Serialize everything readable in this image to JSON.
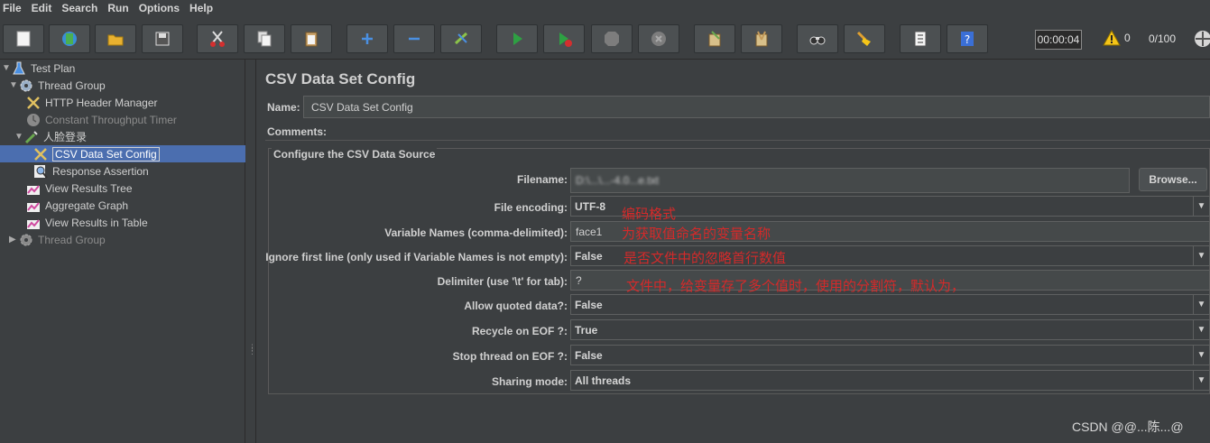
{
  "menu": [
    "File",
    "Edit",
    "Search",
    "Run",
    "Options",
    "Help"
  ],
  "toolbar": {
    "buttons": [
      "new-icon",
      "templates-icon",
      "open-icon",
      "save-icon",
      "cut-icon",
      "copy-icon",
      "paste-icon",
      "expand-icon",
      "collapse-icon",
      "toggle-icon",
      "start-icon",
      "start-no-pause-icon",
      "stop-icon",
      "shutdown-icon",
      "clear-icon",
      "clear-all-icon",
      "search-icon",
      "reset-search-icon",
      "function-helper-icon",
      "help-icon"
    ],
    "timer": "00:00:04",
    "warnings": "0",
    "threads": "0/100"
  },
  "tree": [
    {
      "label": "Test Plan",
      "icon": "flask-icon",
      "expanded": true
    },
    {
      "label": "Thread Group",
      "icon": "gear-icon",
      "expanded": true
    },
    {
      "label": "HTTP Header Manager",
      "icon": "tools-icon"
    },
    {
      "label": "Constant Throughput Timer",
      "icon": "timer-icon"
    },
    {
      "label": "人脸登录",
      "icon": "pipette-icon",
      "expanded": true
    },
    {
      "label": "CSV Data Set Config",
      "icon": "tools-icon",
      "selected": true
    },
    {
      "label": "Response Assertion",
      "icon": "magnifier-icon"
    },
    {
      "label": "View Results Tree",
      "icon": "graph-icon"
    },
    {
      "label": "Aggregate Graph",
      "icon": "graph-icon"
    },
    {
      "label": "View Results in Table",
      "icon": "graph-icon"
    },
    {
      "label": "Thread Group",
      "icon": "gear-icon",
      "expanded": false
    }
  ],
  "panel": {
    "title": "CSV Data Set Config",
    "name_label": "Name:",
    "name_value": "CSV Data Set Config",
    "comments_label": "Comments:",
    "group_title": "Configure the CSV Data Source",
    "filename_label": "Filename:",
    "filename_value": "D:\\...\\...-4.0...e.txt",
    "browse_label": "Browse...",
    "fields": [
      {
        "label": "File encoding:",
        "value": "UTF-8",
        "type": "combo"
      },
      {
        "label": "Variable Names (comma-delimited):",
        "value": "face1",
        "type": "text"
      },
      {
        "label": "Ignore first line (only used if Variable Names is not empty):",
        "value": "False",
        "type": "combo"
      },
      {
        "label": "Delimiter (use '\\t' for tab):",
        "value": "?",
        "type": "text"
      },
      {
        "label": "Allow quoted data?:",
        "value": "False",
        "type": "combo"
      },
      {
        "label": "Recycle on EOF ?:",
        "value": "True",
        "type": "combo"
      },
      {
        "label": "Stop thread on EOF ?:",
        "value": "False",
        "type": "combo"
      },
      {
        "label": "Sharing mode:",
        "value": "All threads",
        "type": "combo"
      }
    ]
  },
  "annotations": [
    "编码格式",
    "为获取值命名的变量名称",
    "是否文件中的忽略首行数值",
    "文件中，给变量存了多个值时，使用的分割符，默认为，"
  ],
  "watermark": "CSDN @@...陈...@",
  "colors": {
    "background": "#3c3f41",
    "selection": "#4b6eaf",
    "annotation": "#d42a2a"
  }
}
